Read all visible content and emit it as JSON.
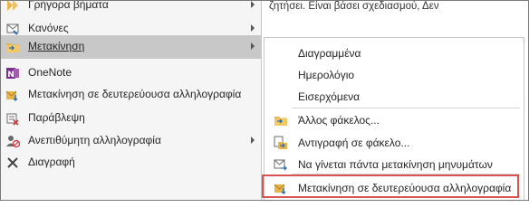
{
  "background": {
    "email_snippet": "ζητήσει. Είναι βάσει σχεδιασμού, Δεν"
  },
  "main_menu": {
    "items": [
      {
        "label": "Γρήγορα βήματα",
        "icon": "quick-steps-icon",
        "has_submenu": true
      },
      {
        "label": "Κανόνες",
        "icon": "rules-icon",
        "has_submenu": true
      },
      {
        "label": "Μετακίνηση",
        "icon": "folder-move-icon",
        "has_submenu": true,
        "active": true
      },
      {
        "label": "OneNote",
        "icon": "onenote-icon",
        "has_submenu": false
      },
      {
        "label": "Μετακίνηση σε δευτερεύουσα αλληλογραφία",
        "icon": "clutter-icon",
        "has_submenu": false
      },
      {
        "label": "Παράβλεψη",
        "icon": "ignore-icon",
        "has_submenu": false
      },
      {
        "label": "Ανεπιθύμητη αλληλογραφία",
        "icon": "junk-mail-icon",
        "has_submenu": true
      },
      {
        "label": "Διαγραφή",
        "icon": "delete-icon",
        "has_submenu": false
      }
    ]
  },
  "submenu": {
    "folders": [
      "Διαγραμμένα",
      "Ημερολόγιο",
      "Εισερχόμενα"
    ],
    "actions": [
      {
        "label": "Άλλος φάκελος...",
        "icon": "other-folder-icon"
      },
      {
        "label": "Αντιγραφή σε φάκελο...",
        "icon": "copy-to-folder-icon"
      },
      {
        "label": "Να γίνεται πάντα μετακίνηση μηνυμάτων",
        "icon": "always-move-icon"
      },
      {
        "label": "Μετακίνηση σε δευτερεύουσα αλληλογραφία",
        "icon": "clutter-icon",
        "highlighted": true
      }
    ]
  },
  "colors": {
    "menu_bg": "#f5f5f5",
    "active_bg": "#c8c8c8",
    "highlight_border": "#d9534f",
    "folder_yellow": "#e8b548",
    "onenote_purple": "#7b2e8c"
  }
}
